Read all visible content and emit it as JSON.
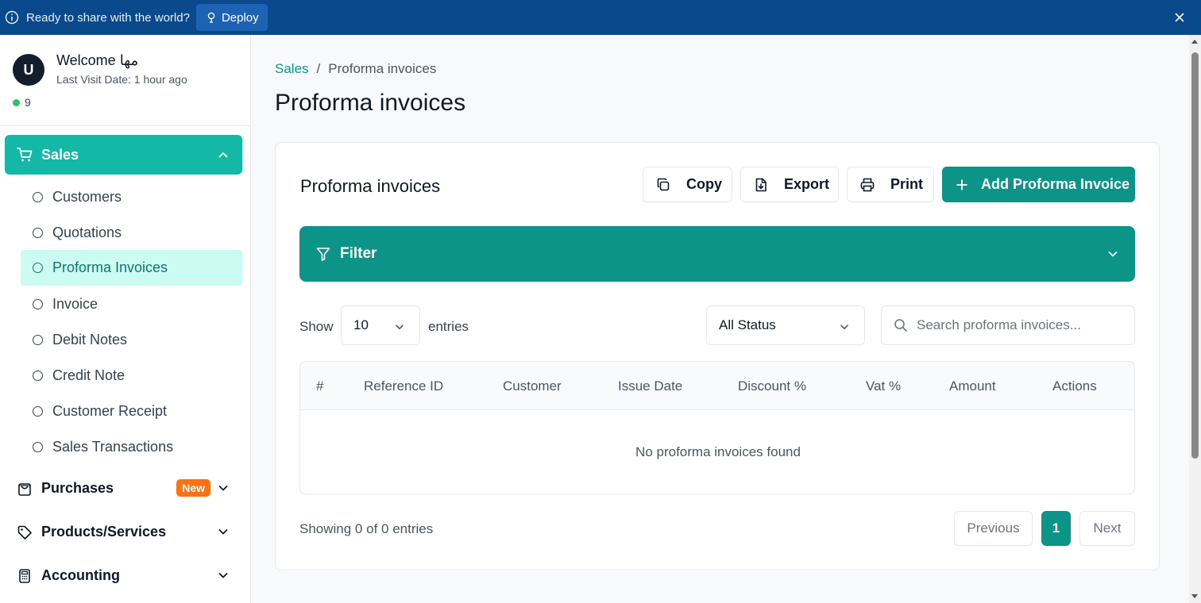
{
  "banner": {
    "text": "Ready to share with the world?",
    "deploy_label": "Deploy",
    "background": "#0a4a8c"
  },
  "profile": {
    "avatar_letter": "U",
    "welcome": "Welcome مها",
    "last_visit": "Last Visit Date: 1 hour ago",
    "online_count": "9"
  },
  "sidebar": {
    "sales_label": "Sales",
    "sales_items": [
      {
        "label": "Customers"
      },
      {
        "label": "Quotations"
      },
      {
        "label": "Proforma Invoices",
        "active": true
      },
      {
        "label": "Invoice"
      },
      {
        "label": "Debit Notes"
      },
      {
        "label": "Credit Note"
      },
      {
        "label": "Customer Receipt"
      },
      {
        "label": "Sales Transactions"
      }
    ],
    "groups": [
      {
        "label": "Purchases",
        "badge": "New",
        "icon": "shopping-bag-icon"
      },
      {
        "label": "Products/Services",
        "icon": "tag-icon"
      },
      {
        "label": "Accounting",
        "icon": "calculator-icon"
      }
    ]
  },
  "breadcrumb": {
    "parent": "Sales",
    "separator": "/",
    "current": "Proforma invoices"
  },
  "page": {
    "title": "Proforma invoices"
  },
  "card": {
    "title": "Proforma invoices",
    "copy_label": "Copy",
    "export_label": "Export",
    "print_label": "Print",
    "add_label": "Add Proforma Invoice",
    "filter_label": "Filter",
    "show_label": "Show",
    "entries_value": "10",
    "entries_label": "entries",
    "status_value": "All Status",
    "search_placeholder": "Search proforma invoices...",
    "columns": [
      "#",
      "Reference ID",
      "Customer",
      "Issue Date",
      "Discount %",
      "Vat %",
      "Amount",
      "Actions"
    ],
    "empty_message": "No proforma invoices found",
    "showing_text": "Showing 0 of 0 entries",
    "pagination": {
      "previous": "Previous",
      "current": "1",
      "next": "Next"
    },
    "accent": "#0d9488"
  }
}
